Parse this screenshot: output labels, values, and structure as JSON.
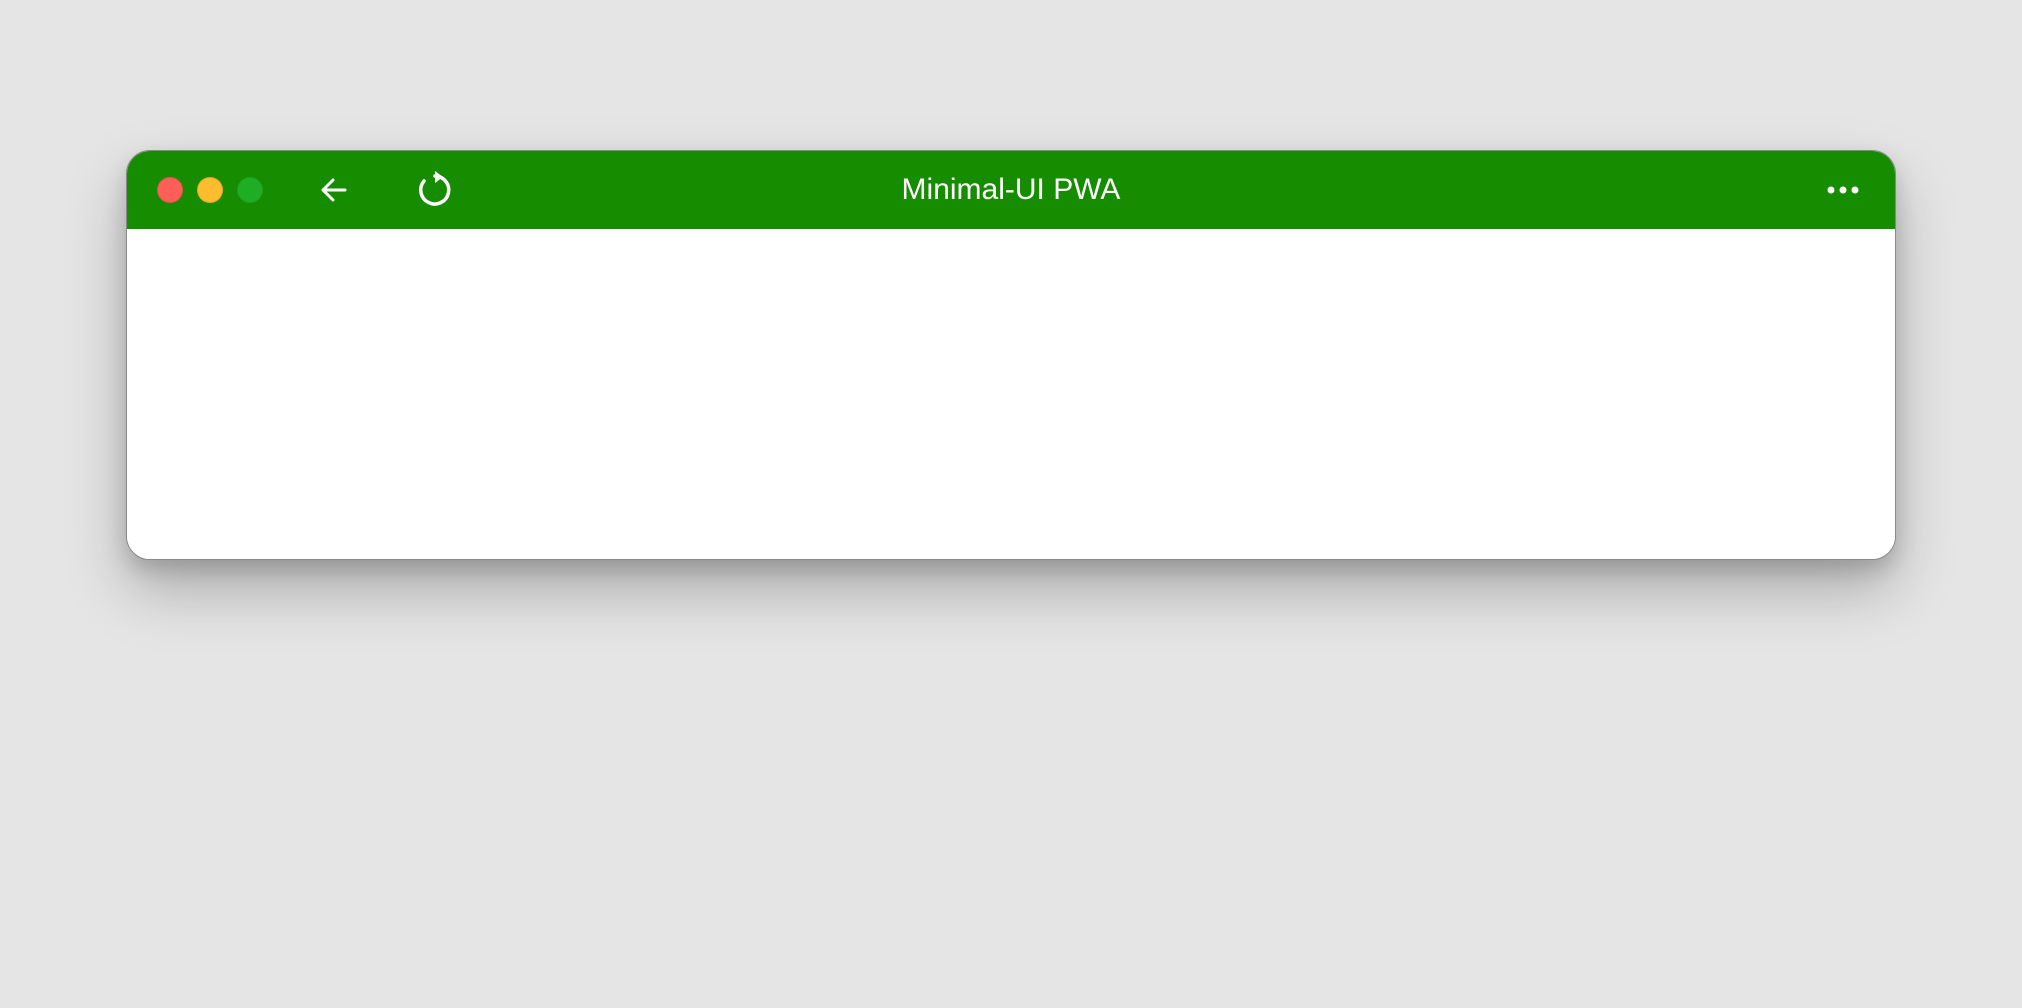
{
  "window": {
    "title": "Minimal-UI PWA",
    "colors": {
      "titlebar_bg": "#168c00",
      "close": "#ff5f57",
      "minimize": "#febc2e",
      "maximize": "#28c840",
      "content_bg": "#ffffff",
      "page_bg": "#e5e5e5"
    },
    "icons": {
      "back": "back-arrow-icon",
      "reload": "reload-icon",
      "menu": "more-options-icon"
    }
  }
}
